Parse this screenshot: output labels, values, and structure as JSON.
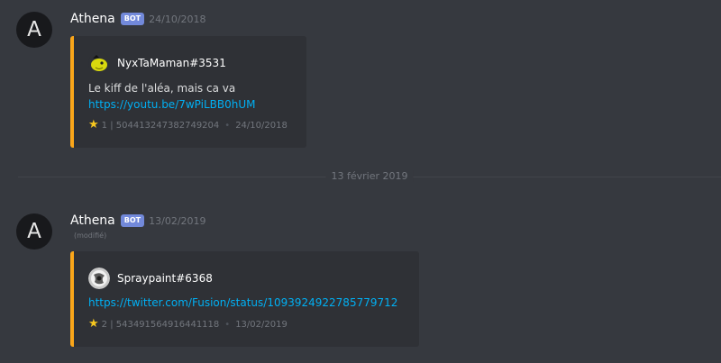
{
  "messages": [
    {
      "avatar_letter": "A",
      "username": "Athena",
      "bot_tag": "BOT",
      "timestamp": "24/10/2018",
      "embed": {
        "accent_color": "#faa61a",
        "author": "NyxTaMaman#3531",
        "author_avatar": "yellow-pacman-avatar",
        "text": "Le kiff de l'aléa, mais ca va",
        "link": "https://youtu.be/7wPiLBB0hUM",
        "footer_icon": "star-icon",
        "footer_id": "1 | 504413247382749204",
        "footer_date": "24/10/2018"
      }
    },
    {
      "avatar_letter": "A",
      "username": "Athena",
      "bot_tag": "BOT",
      "timestamp": "13/02/2019",
      "edited": "(modifié)",
      "embed": {
        "accent_color": "#faa61a",
        "author": "Spraypaint#6368",
        "author_avatar": "grey-sketch-avatar",
        "link": "https://twitter.com/Fusion/status/1093924922785779712",
        "footer_icon": "star-icon",
        "footer_id": "2 | 543491564916441118",
        "footer_date": "13/02/2019"
      }
    }
  ],
  "date_divider": "13 février 2019",
  "colors": {
    "background": "#36393f",
    "embed_background": "#2f3136",
    "bot_tag": "#7289da",
    "link": "#00b0f4"
  }
}
